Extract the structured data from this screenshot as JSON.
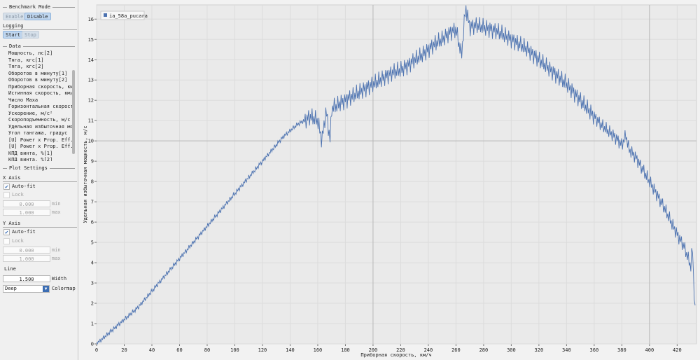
{
  "sidebar": {
    "benchmark": {
      "title": "Benchmark Mode",
      "enable_label": "Enable",
      "disable_label": "Disable"
    },
    "logging": {
      "title": "Logging",
      "start_label": "Start",
      "stop_label": "Stop"
    },
    "data": {
      "title": "Data",
      "items": [
        "Мощность, лс[2]",
        "Тяга, кгс[1]",
        "Тяга, кгс[2]",
        "Оборотов в минуту[1]",
        "Оборотов в минуту[2]",
        "Приборная скорость, км/",
        "Истинная скорость, км/ч",
        "Число Маха",
        "Горизонтальная скорость",
        "Ускорение, м/с²",
        "Скороподъемность, м/с",
        "Удельная избыточная мощ",
        "Угол тангажа, градус",
        "[U] Power x Prop. Eff.[",
        "[U] Power x Prop. Eff.[",
        "КПД винта, %[1]",
        "КПД винта, %[2]"
      ]
    },
    "plot_settings": {
      "title": "Plot Settings",
      "x_axis": {
        "title": "X Axis",
        "autofit_label": "Auto-fit",
        "autofit_checked": true,
        "lock_label": "Lock",
        "min_value": "0.000",
        "min_label": "min",
        "max_value": "1.000",
        "max_label": "max"
      },
      "y_axis": {
        "title": "Y Axis",
        "autofit_label": "Auto-fit",
        "autofit_checked": true,
        "lock_label": "Lock",
        "min_value": "0.000",
        "min_label": "min",
        "max_value": "1.000",
        "max_label": "max"
      },
      "line": {
        "title": "Line",
        "width_value": "1.500",
        "width_label": "Width",
        "colormap_value": "Deep",
        "colormap_label": "Colormap"
      }
    }
  },
  "chart_data": {
    "type": "line",
    "title": "",
    "xlabel": "Приборная скорость, км/ч",
    "ylabel": "Удельная избыточная мощность, м/с",
    "xlim": [
      0,
      434
    ],
    "ylim": [
      0,
      16.7
    ],
    "x_ticks": [
      0,
      20,
      40,
      60,
      80,
      100,
      120,
      140,
      160,
      180,
      200,
      220,
      240,
      260,
      280,
      300,
      320,
      340,
      360,
      380,
      400,
      420
    ],
    "y_ticks": [
      0,
      1,
      2,
      3,
      4,
      5,
      6,
      7,
      8,
      9,
      10,
      11,
      12,
      13,
      14,
      15,
      16
    ],
    "grid": true,
    "legend": "top-left",
    "crosshair": {
      "x": 400,
      "y": 10
    },
    "series": [
      {
        "name": "ia_58a_pucara",
        "color": "#4c72b0",
        "x": [
          0,
          5,
          10,
          15,
          20,
          25,
          30,
          35,
          40,
          45,
          50,
          55,
          60,
          65,
          70,
          75,
          80,
          85,
          90,
          95,
          100,
          105,
          110,
          115,
          120,
          125,
          130,
          135,
          140,
          145,
          150,
          155,
          160,
          163,
          166,
          169,
          170,
          175,
          180,
          185,
          190,
          195,
          200,
          205,
          210,
          215,
          220,
          225,
          230,
          235,
          240,
          245,
          250,
          255,
          260,
          264,
          267,
          270,
          275,
          280,
          285,
          290,
          295,
          300,
          305,
          310,
          315,
          320,
          325,
          330,
          335,
          340,
          345,
          350,
          355,
          360,
          365,
          370,
          375,
          380,
          383,
          385,
          390,
          395,
          400,
          405,
          410,
          415,
          420,
          425,
          428,
          430,
          431,
          432,
          433
        ],
        "y": [
          0.0,
          0.3,
          0.6,
          0.9,
          1.2,
          1.5,
          1.8,
          2.2,
          2.6,
          3.0,
          3.4,
          3.8,
          4.2,
          4.6,
          5.0,
          5.4,
          5.8,
          6.2,
          6.6,
          7.0,
          7.4,
          7.8,
          8.2,
          8.6,
          9.0,
          9.4,
          9.8,
          10.2,
          10.5,
          10.8,
          11.0,
          11.2,
          11.0,
          10.0,
          11.5,
          10.0,
          11.6,
          11.8,
          12.0,
          12.2,
          12.4,
          12.6,
          12.8,
          13.0,
          13.2,
          13.4,
          13.5,
          13.7,
          14.0,
          14.2,
          14.5,
          14.8,
          15.0,
          15.3,
          15.5,
          14.2,
          16.6,
          15.6,
          15.7,
          15.6,
          15.5,
          15.4,
          15.2,
          15.0,
          14.8,
          14.6,
          14.3,
          14.0,
          13.7,
          13.4,
          13.1,
          12.8,
          12.4,
          12.0,
          11.6,
          11.2,
          10.8,
          10.5,
          10.2,
          9.8,
          10.3,
          9.6,
          9.2,
          8.6,
          8.0,
          7.4,
          6.8,
          6.1,
          5.4,
          4.8,
          4.2,
          3.8,
          4.9,
          3.0,
          1.6
        ]
      }
    ]
  }
}
